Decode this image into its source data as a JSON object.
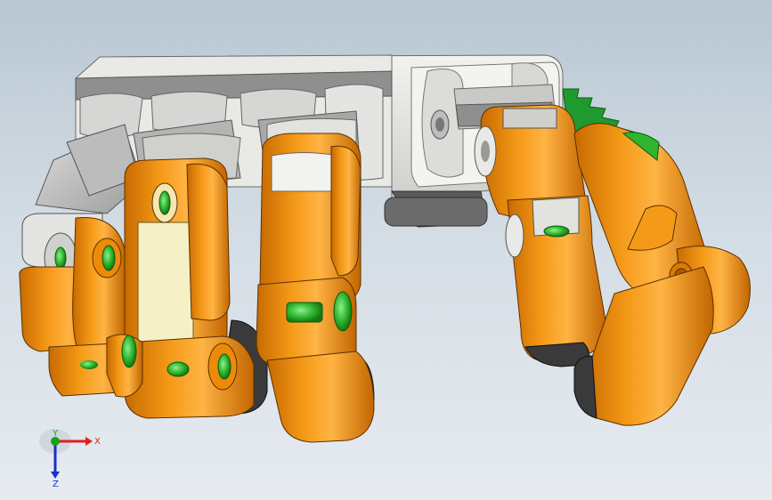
{
  "viewport": {
    "background_top": "#b9c7d3",
    "background_bottom": "#e6ebef"
  },
  "model": {
    "colors": {
      "finger_orange": "#f08a00",
      "finger_highlight": "#ffb84a",
      "finger_shadow": "#b35e00",
      "palm_gray": "#c9c9c9",
      "palm_light": "#ebebe8",
      "pin_green": "#2fb52f",
      "gear_green": "#1f9a2f",
      "pad_cream": "#f6f0c6",
      "rubber_dark": "#3a3a3a"
    }
  },
  "triad": {
    "x_label": "X",
    "y_label": "Y",
    "z_label": "Z",
    "x_color": "#e0201a",
    "y_color": "#1aa01a",
    "z_color": "#1a2ed0"
  }
}
